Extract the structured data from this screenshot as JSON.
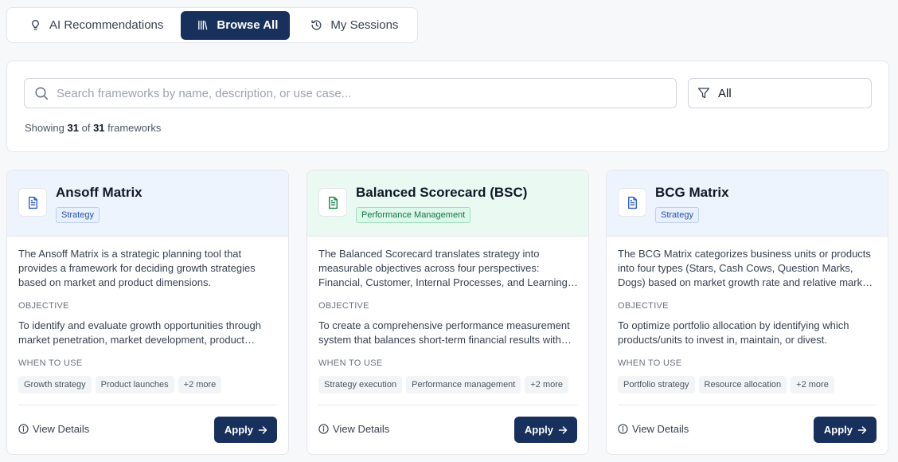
{
  "tabs": [
    {
      "label": "AI Recommendations",
      "icon": "lightbulb-icon",
      "active": false
    },
    {
      "label": "Browse All",
      "icon": "library-icon",
      "active": true
    },
    {
      "label": "My Sessions",
      "icon": "history-icon",
      "active": false
    }
  ],
  "search": {
    "placeholder": "Search frameworks by name, description, or use case...",
    "value": ""
  },
  "filter": {
    "selected": "All",
    "icon": "filter-icon"
  },
  "results": {
    "prefix": "Showing",
    "shown": "31",
    "of": "of",
    "total": "31",
    "suffix": "frameworks"
  },
  "cards": [
    {
      "title": "Ansoff Matrix",
      "category": "Strategy",
      "description": "The Ansoff Matrix is a strategic planning tool that provides a framework for deciding growth strategies based on market and product dimensions.",
      "objective_label": "OBJECTIVE",
      "objective": "To identify and evaluate growth opportunities through market penetration, market development, product development, and diversification.",
      "when_label": "WHEN TO USE",
      "use_cases": [
        "Growth strategy",
        "Product launches",
        "+2 more"
      ],
      "view_label": "View Details",
      "apply_label": "Apply"
    },
    {
      "title": "Balanced Scorecard (BSC)",
      "category": "Performance Management",
      "description": "The Balanced Scorecard translates strategy into measurable objectives across four perspectives: Financial, Customer, Internal Processes, and Learning and Growth.",
      "objective_label": "OBJECTIVE",
      "objective": "To create a comprehensive performance measurement system that balances short-term financial results with long-term drivers.",
      "when_label": "WHEN TO USE",
      "use_cases": [
        "Strategy execution",
        "Performance management",
        "+2 more"
      ],
      "view_label": "View Details",
      "apply_label": "Apply"
    },
    {
      "title": "BCG Matrix",
      "category": "Strategy",
      "description": "The BCG Matrix categorizes business units or products into four types (Stars, Cash Cows, Question Marks, Dogs) based on market growth rate and relative market share.",
      "objective_label": "OBJECTIVE",
      "objective": "To optimize portfolio allocation by identifying which products/units to invest in, maintain, or divest.",
      "when_label": "WHEN TO USE",
      "use_cases": [
        "Portfolio strategy",
        "Resource allocation",
        "+2 more"
      ],
      "view_label": "View Details",
      "apply_label": "Apply"
    }
  ],
  "colors": {
    "primary": "#17305c",
    "strategy_tag": "#2452a8",
    "performance_tag": "#167245"
  }
}
